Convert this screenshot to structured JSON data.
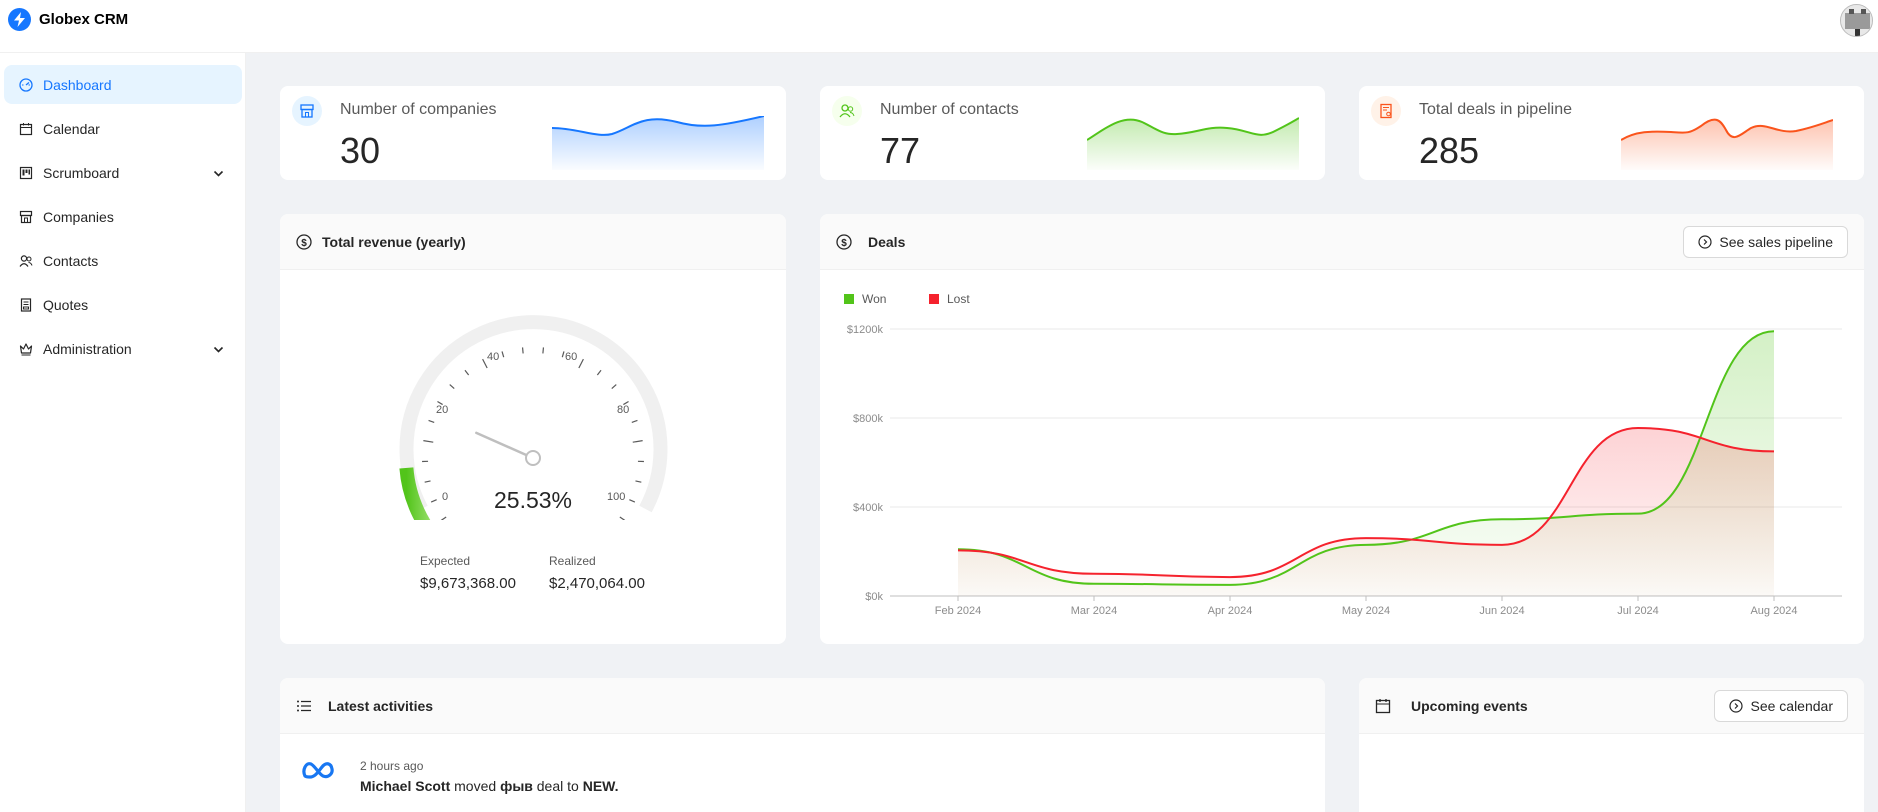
{
  "app": {
    "name": "Globex CRM"
  },
  "sidebar": {
    "items": [
      {
        "label": "Dashboard",
        "icon": "dashboard-icon",
        "active": true
      },
      {
        "label": "Calendar",
        "icon": "calendar-icon"
      },
      {
        "label": "Scrumboard",
        "icon": "project-icon",
        "has_submenu": true
      },
      {
        "label": "Companies",
        "icon": "shop-icon"
      },
      {
        "label": "Contacts",
        "icon": "team-icon"
      },
      {
        "label": "Quotes",
        "icon": "container-icon"
      },
      {
        "label": "Administration",
        "icon": "crown-icon",
        "has_submenu": true
      }
    ]
  },
  "stats": [
    {
      "label": "Number of companies",
      "value": "30",
      "color": "#1677ff",
      "icon": "shop-icon"
    },
    {
      "label": "Number of contacts",
      "value": "77",
      "color": "#52c41a",
      "icon": "team-icon"
    },
    {
      "label": "Total deals in pipeline",
      "value": "285",
      "color": "#fa541c",
      "icon": "audit-icon"
    }
  ],
  "revenue": {
    "title": "Total revenue (yearly)",
    "percent_text": "25.53%",
    "percent": 25.53,
    "ticks": [
      "0",
      "20",
      "40",
      "60",
      "80",
      "100"
    ],
    "expected_label": "Expected",
    "expected_value": "$9,673,368.00",
    "realized_label": "Realized",
    "realized_value": "$2,470,064.00"
  },
  "deals": {
    "title": "Deals",
    "button_label": "See sales pipeline"
  },
  "chart_data": {
    "type": "area",
    "x": [
      "Feb 2024",
      "Mar 2024",
      "Apr 2024",
      "May 2024",
      "Jun 2024",
      "Jul 2024",
      "Aug 2024"
    ],
    "y_ticks": [
      "$0k",
      "$400k",
      "$800k",
      "$1200k"
    ],
    "ylim": [
      0,
      1200
    ],
    "series": [
      {
        "name": "Won",
        "color": "#52c41a",
        "values": [
          210,
          55,
          50,
          230,
          345,
          370,
          1190
        ]
      },
      {
        "name": "Lost",
        "color": "#f5222d",
        "values": [
          205,
          100,
          85,
          260,
          230,
          755,
          650
        ]
      }
    ],
    "legend_position": "top-left",
    "grid": true
  },
  "activities": {
    "title": "Latest activities",
    "items": [
      {
        "time": "2 hours ago",
        "user": "Michael Scott",
        "verb": "moved",
        "deal": "фыв",
        "mid": "deal to",
        "stage": "NEW."
      }
    ]
  },
  "events": {
    "title": "Upcoming events",
    "button_label": "See calendar"
  }
}
